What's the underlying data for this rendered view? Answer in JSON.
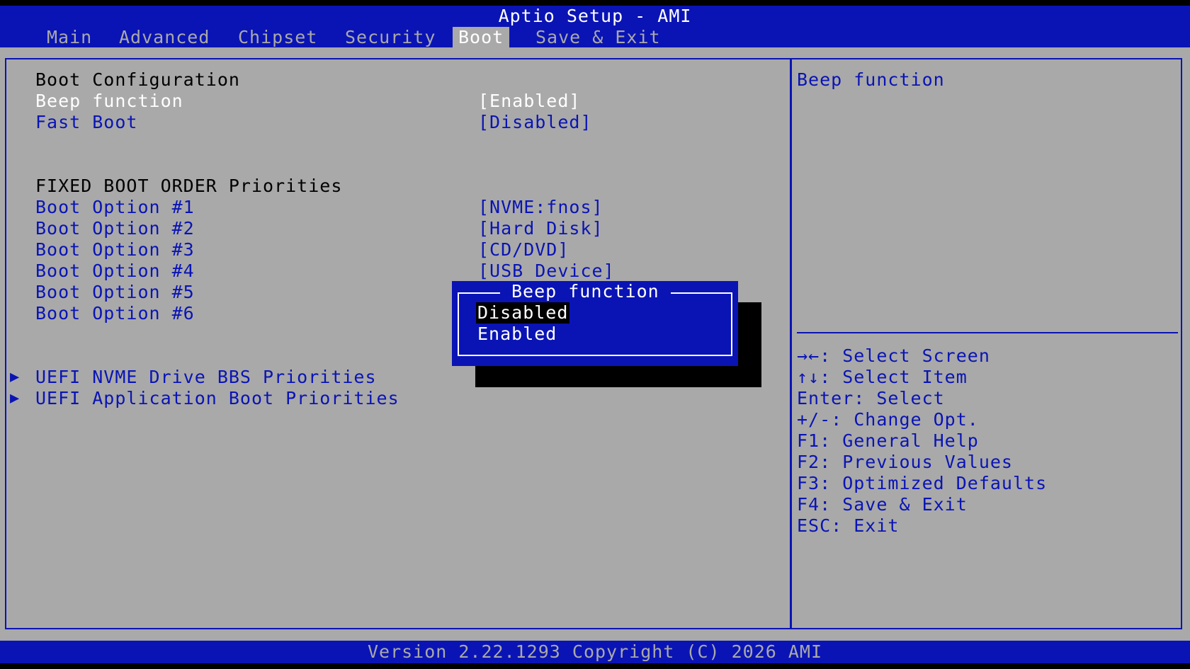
{
  "header": {
    "title": "Aptio Setup - AMI",
    "tabs": [
      {
        "label": "Main",
        "active": false
      },
      {
        "label": "Advanced",
        "active": false
      },
      {
        "label": "Chipset",
        "active": false
      },
      {
        "label": "Security",
        "active": false
      },
      {
        "label": "Boot",
        "active": true
      },
      {
        "label": "Save & Exit",
        "active": false
      }
    ]
  },
  "main": {
    "boot_config_header": "Boot Configuration",
    "beep_function": {
      "label": "Beep function",
      "value": "[Enabled]"
    },
    "fast_boot": {
      "label": "Fast Boot",
      "value": "[Disabled]"
    },
    "fixed_order_header": "FIXED BOOT ORDER Priorities",
    "boot_options": [
      {
        "label": "Boot Option #1",
        "value": "[NVME:fnos]"
      },
      {
        "label": "Boot Option #2",
        "value": "[Hard Disk]"
      },
      {
        "label": "Boot Option #3",
        "value": "[CD/DVD]"
      },
      {
        "label": "Boot Option #4",
        "value": "[USB Device]"
      },
      {
        "label": "Boot Option #5",
        "value": ""
      },
      {
        "label": "Boot Option #6",
        "value": ""
      }
    ],
    "submenus": [
      {
        "label": "UEFI NVME Drive BBS Priorities"
      },
      {
        "label": "UEFI Application Boot Priorities"
      }
    ],
    "submenu_arrow": "▶"
  },
  "help": {
    "description": "Beep function",
    "keys": [
      "→←: Select Screen",
      "↑↓: Select Item",
      "Enter: Select",
      "+/-: Change Opt.",
      "F1: General Help",
      "F2: Previous Values",
      "F3: Optimized Defaults",
      "F4: Save & Exit",
      "ESC: Exit"
    ]
  },
  "popup": {
    "title": "Beep function",
    "options": [
      {
        "label": "Disabled",
        "selected": true
      },
      {
        "label": "Enabled",
        "selected": false
      }
    ]
  },
  "footer": {
    "version": "Version 2.22.1293 Copyright (C) 2026 AMI"
  },
  "colors": {
    "bios_blue": "#0a14b4",
    "panel_gray": "#a9a9a9",
    "highlight_white": "#ffffff"
  }
}
